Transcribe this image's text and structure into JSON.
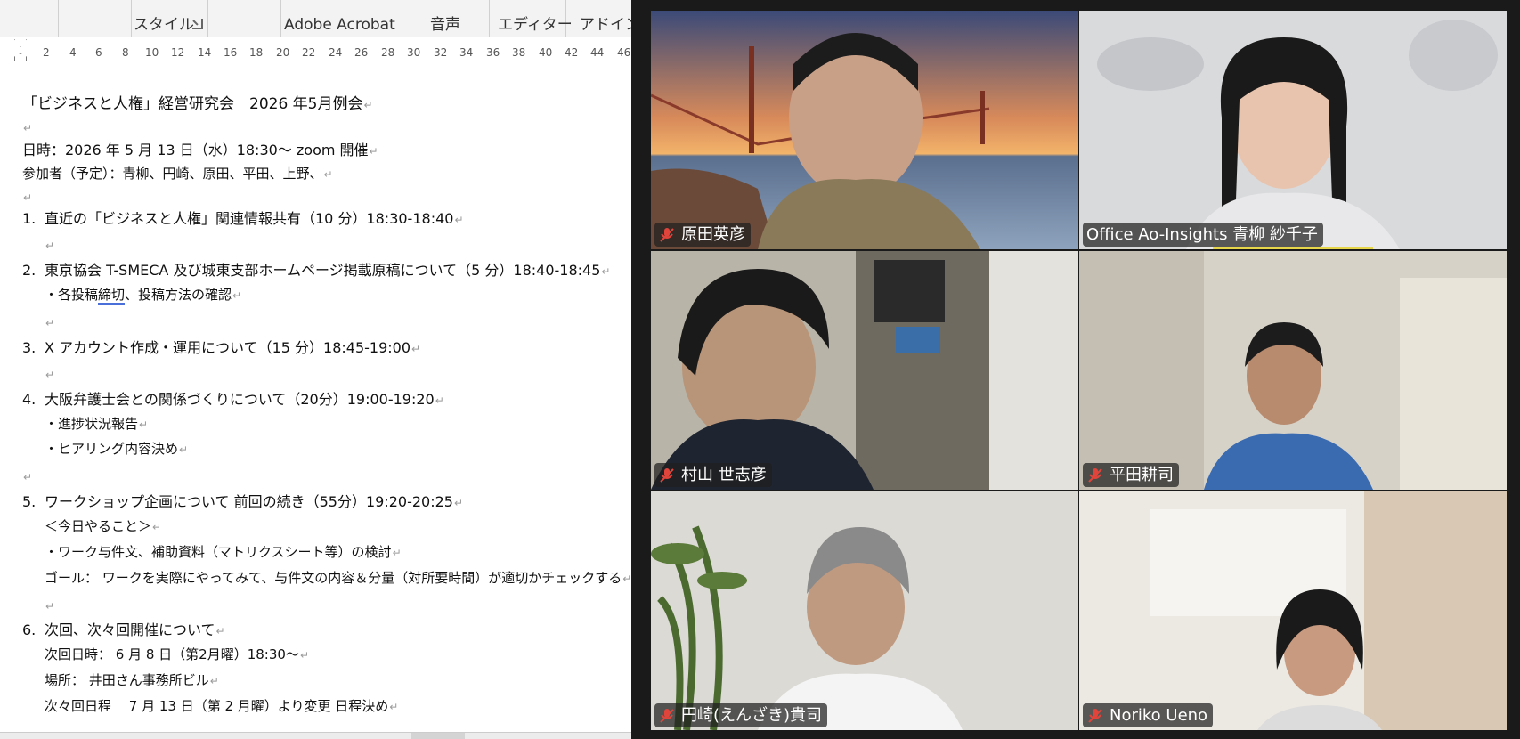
{
  "ribbon": {
    "groups": [
      "スタイル",
      "Adobe Acrobat",
      "音声",
      "エディター",
      "アドイン"
    ]
  },
  "ruler": {
    "ticks": [
      "2",
      "4",
      "6",
      "8",
      "10",
      "12",
      "14",
      "16",
      "18",
      "20",
      "22",
      "24",
      "26",
      "28",
      "30",
      "32",
      "34",
      "36",
      "38",
      "40",
      "42",
      "44",
      "46"
    ]
  },
  "document": {
    "title": "「ビジネスと人権」経営研究会　2026 年5月例会",
    "datetime": "日時：2026 年 5 月 13 日（水）18:30～  zoom 開催",
    "participants": "参加者（予定）：青柳、円崎、原田、平田、上野、",
    "items": [
      {
        "num": "1.",
        "text": "直近の「ビジネスと人権」関連情報共有（10 分）18:30-18:40"
      },
      {
        "num": "2.",
        "text": "東京協会 T-SMECA 及び城東支部ホームページ掲載原稿について（5 分）18:40-18:45"
      },
      {
        "num": "3.",
        "text": "X アカウント作成・運用について（15 分）18:45-19:00"
      },
      {
        "num": "4.",
        "text": "大阪弁護士会との関係づくりについて（20分）19:00-19:20"
      },
      {
        "num": "5.",
        "text": "ワークショップ企画について  前回の続き（55分）19:20-20:25"
      },
      {
        "num": "6.",
        "text": "次回、次々回開催について"
      }
    ],
    "item2_sub_prefix": "・各投稿",
    "item2_sub_underlined": "締切",
    "item2_sub_suffix": "、投稿方法の確認",
    "item4_sub1": "・進捗状況報告",
    "item4_sub2": "・ヒアリング内容決め",
    "item5_sub1": "＜今日やること＞",
    "item5_sub2": "・ワーク与件文、補助資料（マトリクスシート等）の検討",
    "item5_sub3": "ゴール：  ワークを実際にやってみて、与件文の内容＆分量（対所要時間）が適切かチェックする",
    "item6_sub1": "次回日時：  6 月 8 日（第2月曜）18:30～",
    "item6_sub2": "場所：  井田さん事務所ビル",
    "item6_sub3": "次々回日程　 7 月 13 日（第 2 月曜）より変更  日程決め"
  },
  "participants": [
    {
      "name": "原田英彦",
      "muted": true,
      "active_speaker": true,
      "icon": "mic-muted-icon"
    },
    {
      "name": "Office Ao-Insights 青柳 紗千子",
      "muted": false,
      "active_speaker": false
    },
    {
      "name": "村山 世志彦",
      "muted": true,
      "active_speaker": false,
      "icon": "mic-muted-icon"
    },
    {
      "name": "平田耕司",
      "muted": true,
      "active_speaker": false,
      "icon": "mic-muted-icon"
    },
    {
      "name": "円崎(えんざき)貴司",
      "muted": true,
      "active_speaker": false,
      "icon": "mic-muted-icon"
    },
    {
      "name": "Noriko Ueno",
      "muted": true,
      "active_speaker": false,
      "icon": "mic-muted-icon"
    }
  ],
  "colors": {
    "active_border": "#2fd47e",
    "muted_icon": "#e0443b",
    "speaking_bar": "#e8d64a"
  }
}
